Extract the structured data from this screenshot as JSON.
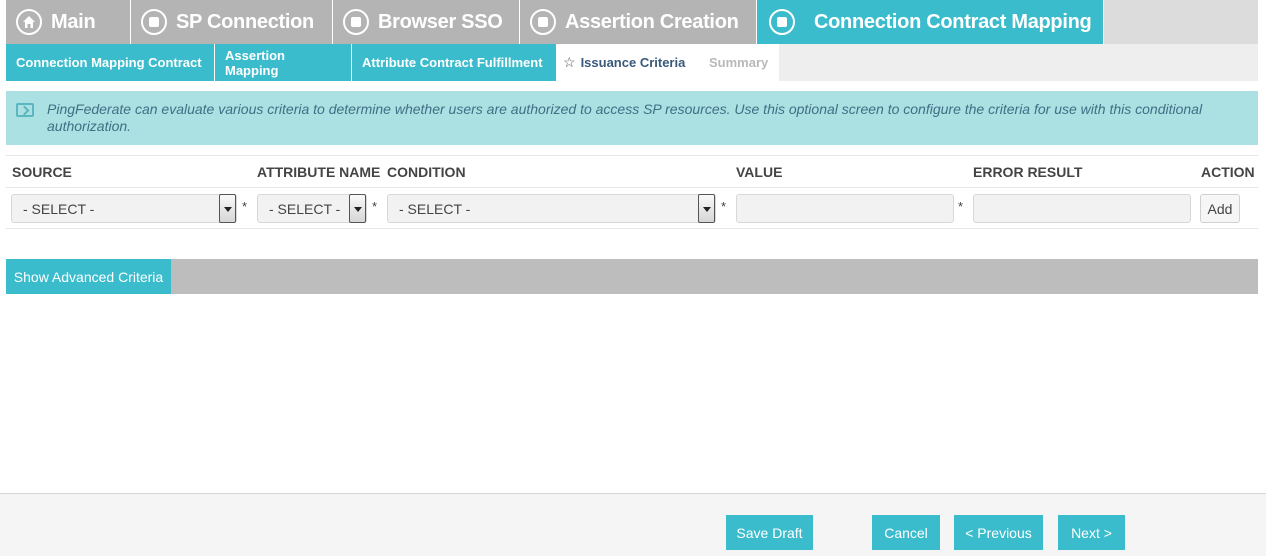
{
  "top_tabs": [
    {
      "label": "Main",
      "icon": "home-icon"
    },
    {
      "label": "SP Connection",
      "icon": "step-icon"
    },
    {
      "label": "Browser SSO",
      "icon": "step-icon"
    },
    {
      "label": "Assertion Creation",
      "icon": "step-icon"
    },
    {
      "label": "Connection Contract Mapping",
      "icon": "step-icon",
      "active": true
    }
  ],
  "sub_tabs": [
    {
      "label": "Connection Mapping Contract"
    },
    {
      "label": "Assertion Mapping"
    },
    {
      "label": "Attribute Contract Fulfillment"
    },
    {
      "label": "Issuance Criteria",
      "active": true
    },
    {
      "label": "Summary",
      "disabled": true
    }
  ],
  "info": {
    "text": "PingFederate can evaluate various criteria to determine whether users are authorized to access SP resources. Use this optional screen to configure the criteria for use with this conditional authorization."
  },
  "criteria": {
    "headers": {
      "source": "SOURCE",
      "attribute_name": "ATTRIBUTE NAME",
      "condition": "CONDITION",
      "value": "VALUE",
      "error_result": "ERROR RESULT",
      "action": "ACTION"
    },
    "row": {
      "source_selected": "- SELECT -",
      "attribute_selected": "- SELECT -",
      "condition_selected": "- SELECT -",
      "required_mark": "*",
      "value": "",
      "error_result": "",
      "add_label": "Add"
    }
  },
  "advanced": {
    "label": "Show Advanced Criteria"
  },
  "footer": {
    "save_draft": "Save Draft",
    "cancel": "Cancel",
    "previous": "< Previous",
    "next": "Next >"
  },
  "colors": {
    "accent": "#3bbccc",
    "inactive_tab": "#b4b4b4",
    "info_bg": "#abe1e3"
  }
}
